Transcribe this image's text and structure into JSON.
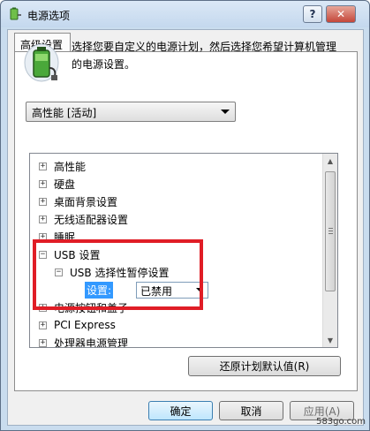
{
  "window": {
    "title": "电源选项",
    "help_glyph": "?",
    "close_glyph": "✕"
  },
  "tab": {
    "label": "高级设置"
  },
  "intro": {
    "text": "选择您要自定义的电源计划，然后选择您希望计算机管理的电源设置。"
  },
  "plan_select": {
    "value": "高性能 [活动]"
  },
  "tree": {
    "items": [
      {
        "expander": "+",
        "label": "高性能"
      },
      {
        "expander": "+",
        "label": "硬盘"
      },
      {
        "expander": "+",
        "label": "桌面背景设置"
      },
      {
        "expander": "+",
        "label": "无线适配器设置"
      },
      {
        "expander": "+",
        "label": "睡眠"
      },
      {
        "expander": "−",
        "label": "USB 设置"
      },
      {
        "expander": "−",
        "label": "USB 选择性暂停设置"
      },
      {
        "expander": "+",
        "label": "电源按钮和盖子"
      },
      {
        "expander": "+",
        "label": "PCI Express"
      },
      {
        "expander": "+",
        "label": "处理器电源管理"
      }
    ],
    "setting_label": "设置:",
    "setting_value": "已禁用"
  },
  "buttons": {
    "restore": "还原计划默认值(R)",
    "ok": "确定",
    "cancel": "取消",
    "apply": "应用(A)"
  },
  "watermark": "583go.com",
  "colors": {
    "highlight_box": "#e01d26",
    "selection": "#3399ff"
  },
  "icons": [
    "power-options-icon",
    "battery-plug-icon",
    "help-icon",
    "close-icon",
    "dropdown-arrow-icon",
    "expand-icon",
    "collapse-icon"
  ]
}
